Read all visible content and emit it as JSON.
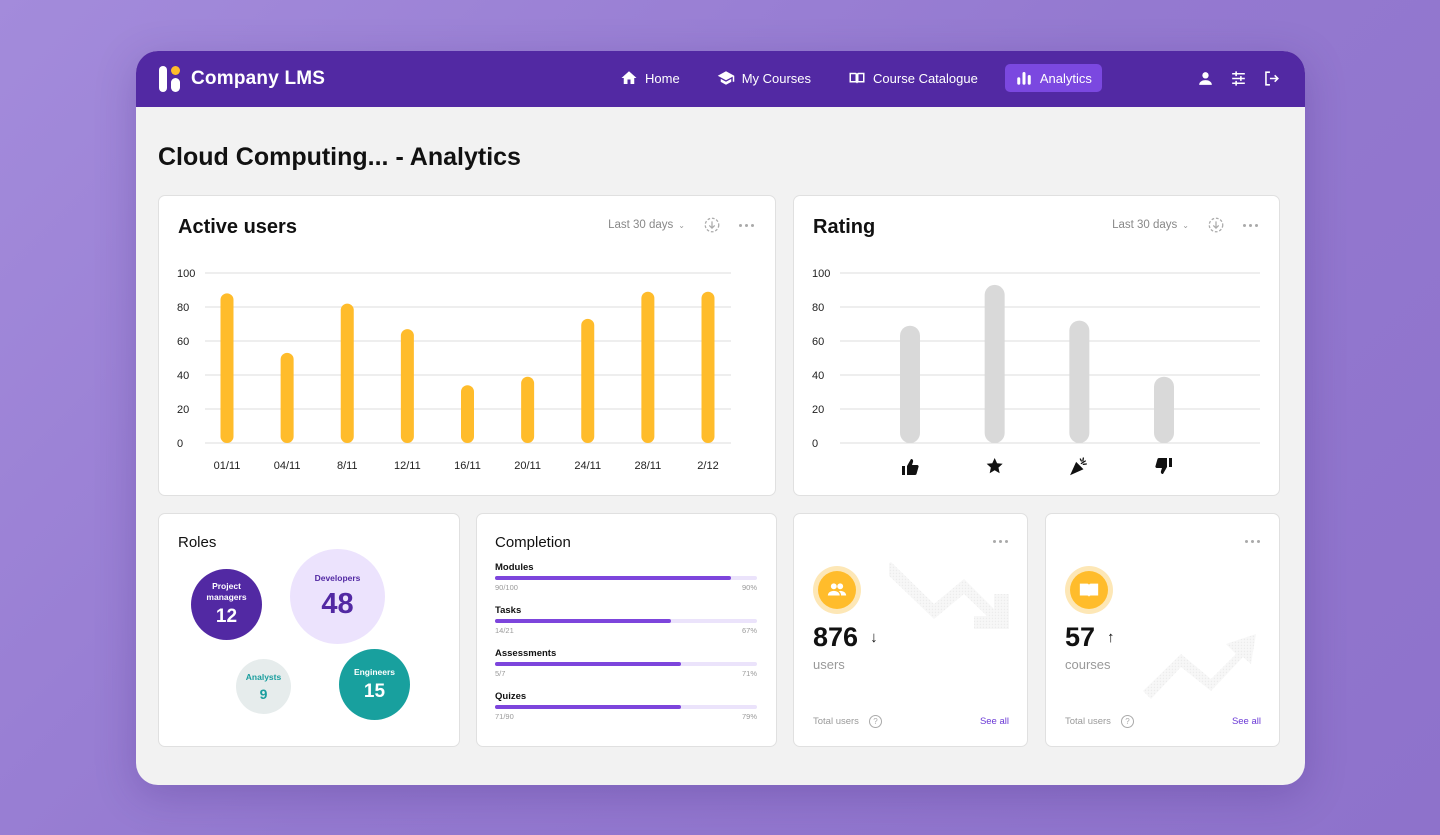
{
  "app": {
    "brand": "Company LMS",
    "accent": "#5229a3",
    "active_nav_color": "#7b48e0",
    "chart_yellow": "#ffbc2b",
    "chart_gray": "#d9d9d9"
  },
  "nav": {
    "items": [
      {
        "label": "Home",
        "icon": "home-icon",
        "active": false
      },
      {
        "label": "My Courses",
        "icon": "graduation-cap-icon",
        "active": false
      },
      {
        "label": "Course Catalogue",
        "icon": "book-open-icon",
        "active": false
      },
      {
        "label": "Analytics",
        "icon": "bar-chart-icon",
        "active": true
      }
    ],
    "right_icons": [
      "user-icon",
      "settings-sliders-icon",
      "logout-icon"
    ]
  },
  "page": {
    "title": "Cloud Computing... - Analytics"
  },
  "active_users": {
    "title": "Active users",
    "range": "Last 30 days",
    "icons": [
      "download-icon",
      "more-icon"
    ]
  },
  "rating": {
    "title": "Rating",
    "range": "Last 30 days",
    "icons": [
      "download-icon",
      "more-icon"
    ]
  },
  "chart_data": [
    {
      "type": "bar",
      "title": "Active users",
      "categories": [
        "01/11",
        "04/11",
        "8/11",
        "12/11",
        "16/11",
        "20/11",
        "24/11",
        "28/11",
        "2/12"
      ],
      "values": [
        88,
        53,
        82,
        67,
        34,
        39,
        73,
        89,
        89
      ],
      "yticks": [
        0,
        20,
        40,
        60,
        80,
        100
      ],
      "ylim": [
        0,
        100
      ],
      "xlabel": "",
      "ylabel": "",
      "grid": true,
      "color": "#ffbc2b"
    },
    {
      "type": "bar",
      "title": "Rating",
      "categories": [
        "thumbs-up",
        "star",
        "celebration",
        "thumbs-down"
      ],
      "category_icons": [
        "thumbs-up-icon",
        "star-icon",
        "party-popper-icon",
        "thumbs-down-icon"
      ],
      "values": [
        69,
        93,
        72,
        39
      ],
      "yticks": [
        0,
        20,
        40,
        60,
        80,
        100
      ],
      "ylim": [
        0,
        100
      ],
      "xlabel": "",
      "ylabel": "",
      "grid": true,
      "color": "#d9d9d9"
    }
  ],
  "roles": {
    "title": "Roles",
    "items": [
      {
        "label_line1": "Project",
        "label_line2": "managers",
        "value": "12",
        "bg": "#5229a3",
        "fg": "#ffffff"
      },
      {
        "label_line1": "Developers",
        "label_line2": "",
        "value": "48",
        "bg": "#ece3fd",
        "fg": "#5229a3"
      },
      {
        "label_line1": "Analysts",
        "label_line2": "",
        "value": "9",
        "bg": "#e6ecec",
        "fg": "#1a9e9e"
      },
      {
        "label_line1": "Engineers",
        "label_line2": "",
        "value": "15",
        "bg": "#18a09e",
        "fg": "#ffffff"
      }
    ]
  },
  "completion": {
    "title": "Completion",
    "items": [
      {
        "label": "Modules",
        "count": "90/100",
        "percent_text": "90%",
        "percent": 90
      },
      {
        "label": "Tasks",
        "count": "14/21",
        "percent_text": "67%",
        "percent": 67
      },
      {
        "label": "Assessments",
        "count": "5/7",
        "percent_text": "71%",
        "percent": 71
      },
      {
        "label": "Quizes",
        "count": "71/90",
        "percent_text": "79%",
        "percent": 71
      }
    ]
  },
  "stats": [
    {
      "value": "876",
      "trend": "↓",
      "trend_dir": "down",
      "unit": "users",
      "footer": "Total users",
      "link": "See all",
      "icon": "users-icon"
    },
    {
      "value": "57",
      "trend": "↑",
      "trend_dir": "up",
      "unit": "courses",
      "footer": "Total users",
      "link": "See all",
      "icon": "book-icon"
    }
  ]
}
